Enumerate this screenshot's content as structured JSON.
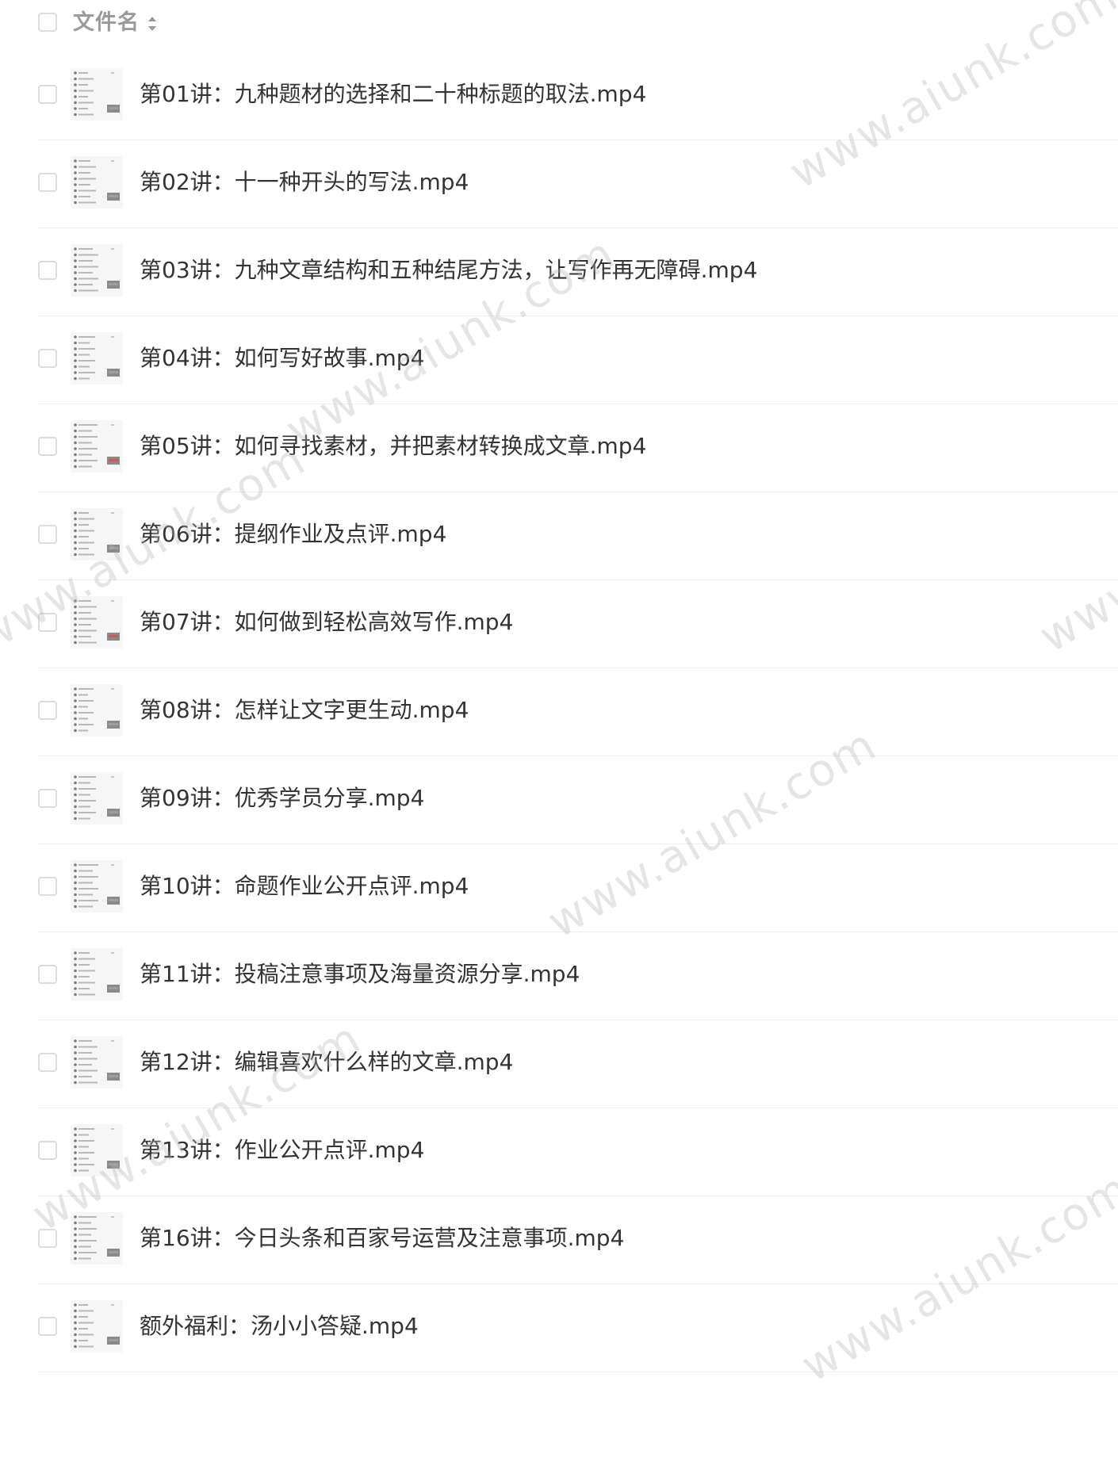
{
  "header": {
    "column_label": "文件名",
    "sort_icon": "sort-updown-icon"
  },
  "files": [
    {
      "name": "第01讲：九种题材的选择和二十种标题的取法.mp4",
      "accent": "#9aa0a6"
    },
    {
      "name": "第02讲：十一种开头的写法.mp4",
      "accent": "#9aa0a6"
    },
    {
      "name": "第03讲：九种文章结构和五种结尾方法，让写作再无障碍.mp4",
      "accent": "#9aa0a6"
    },
    {
      "name": "第04讲：如何写好故事.mp4",
      "accent": "#9aa0a6"
    },
    {
      "name": "第05讲：如何寻找素材，并把素材转换成文章.mp4",
      "accent": "#d9534f"
    },
    {
      "name": "第06讲：提纲作业及点评.mp4",
      "accent": "#9aa0a6"
    },
    {
      "name": "第07讲：如何做到轻松高效写作.mp4",
      "accent": "#d9534f"
    },
    {
      "name": "第08讲：怎样让文字更生动.mp4",
      "accent": "#9aa0a6"
    },
    {
      "name": "第09讲：优秀学员分享.mp4",
      "accent": "#9aa0a6"
    },
    {
      "name": "第10讲：命题作业公开点评.mp4",
      "accent": "#9aa0a6"
    },
    {
      "name": "第11讲：投稿注意事项及海量资源分享.mp4",
      "accent": "#9aa0a6"
    },
    {
      "name": "第12讲：编辑喜欢什么样的文章.mp4",
      "accent": "#9aa0a6"
    },
    {
      "name": "第13讲：作业公开点评.mp4",
      "accent": "#9aa0a6"
    },
    {
      "name": "第16讲：今日头条和百家号运营及注意事项.mp4",
      "accent": "#9aa0a6"
    },
    {
      "name": "额外福利：汤小小答疑.mp4",
      "accent": "#9aa0a6"
    }
  ],
  "watermark_text": "www.aiunk.com"
}
